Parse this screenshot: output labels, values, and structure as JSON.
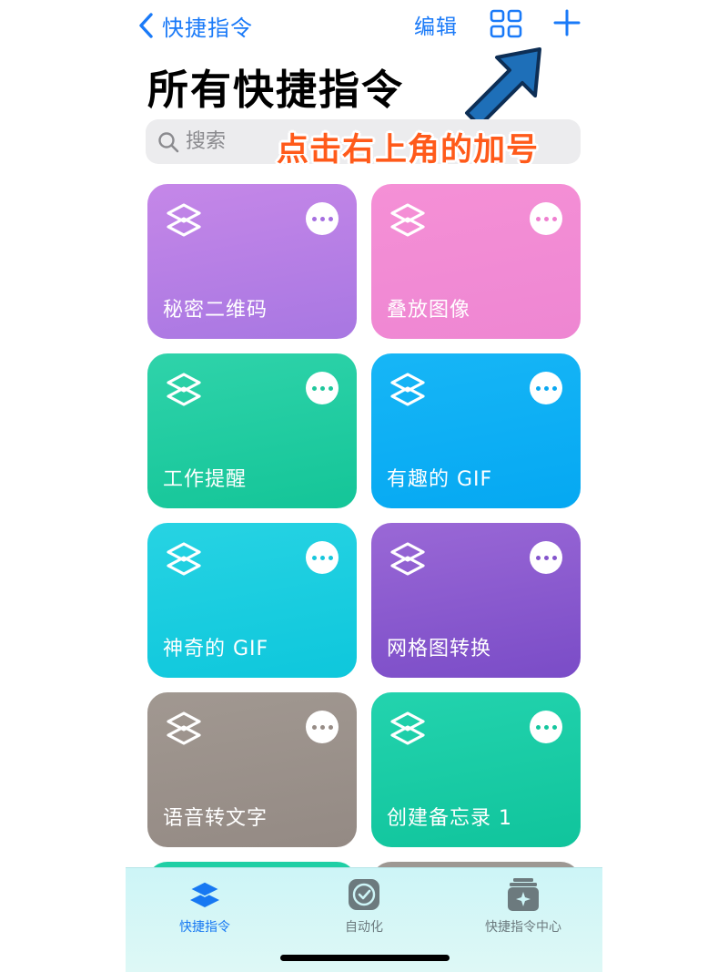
{
  "nav": {
    "back_label": "快捷指令",
    "edit_label": "编辑"
  },
  "page_title": "所有快捷指令",
  "search": {
    "placeholder": "搜索"
  },
  "annotation": "点击右上角的加号",
  "tiles": [
    {
      "label": "秘密二维码",
      "color_top": "#c587e8",
      "color_bottom": "#a877e2",
      "dots": "#a66fe0"
    },
    {
      "label": "叠放图像",
      "color_top": "#f590d6",
      "color_bottom": "#ee86d2",
      "dots": "#ef7fd0"
    },
    {
      "label": "工作提醒",
      "color_top": "#2fd3aa",
      "color_bottom": "#14c598",
      "dots": "#1fc79c"
    },
    {
      "label": "有趣的 GIF",
      "color_top": "#17b6f6",
      "color_bottom": "#05a8f2",
      "dots": "#0aa8f2"
    },
    {
      "label": "神奇的 GIF",
      "color_top": "#27d3e3",
      "color_bottom": "#0ec7dc",
      "dots": "#17c7dc"
    },
    {
      "label": "网格图转换",
      "color_top": "#9a68d6",
      "color_bottom": "#7a4cc7",
      "dots": "#8455cc"
    },
    {
      "label": "语音转文字",
      "color_top": "#a19891",
      "color_bottom": "#948a84",
      "dots": "#978c86"
    },
    {
      "label": "创建备忘录 1",
      "color_top": "#23d3ae",
      "color_bottom": "#10c49c",
      "dots": "#14c69e"
    }
  ],
  "tab_bar": {
    "tabs": [
      {
        "label": "快捷指令",
        "active": true
      },
      {
        "label": "自动化",
        "active": false
      },
      {
        "label": "快捷指令中心",
        "active": false
      }
    ]
  },
  "colors": {
    "accent": "#1a7af8",
    "annotation": "#ff5a1a",
    "arrow": "#1e6fb8",
    "inactive_tab": "#6c7a7e"
  }
}
